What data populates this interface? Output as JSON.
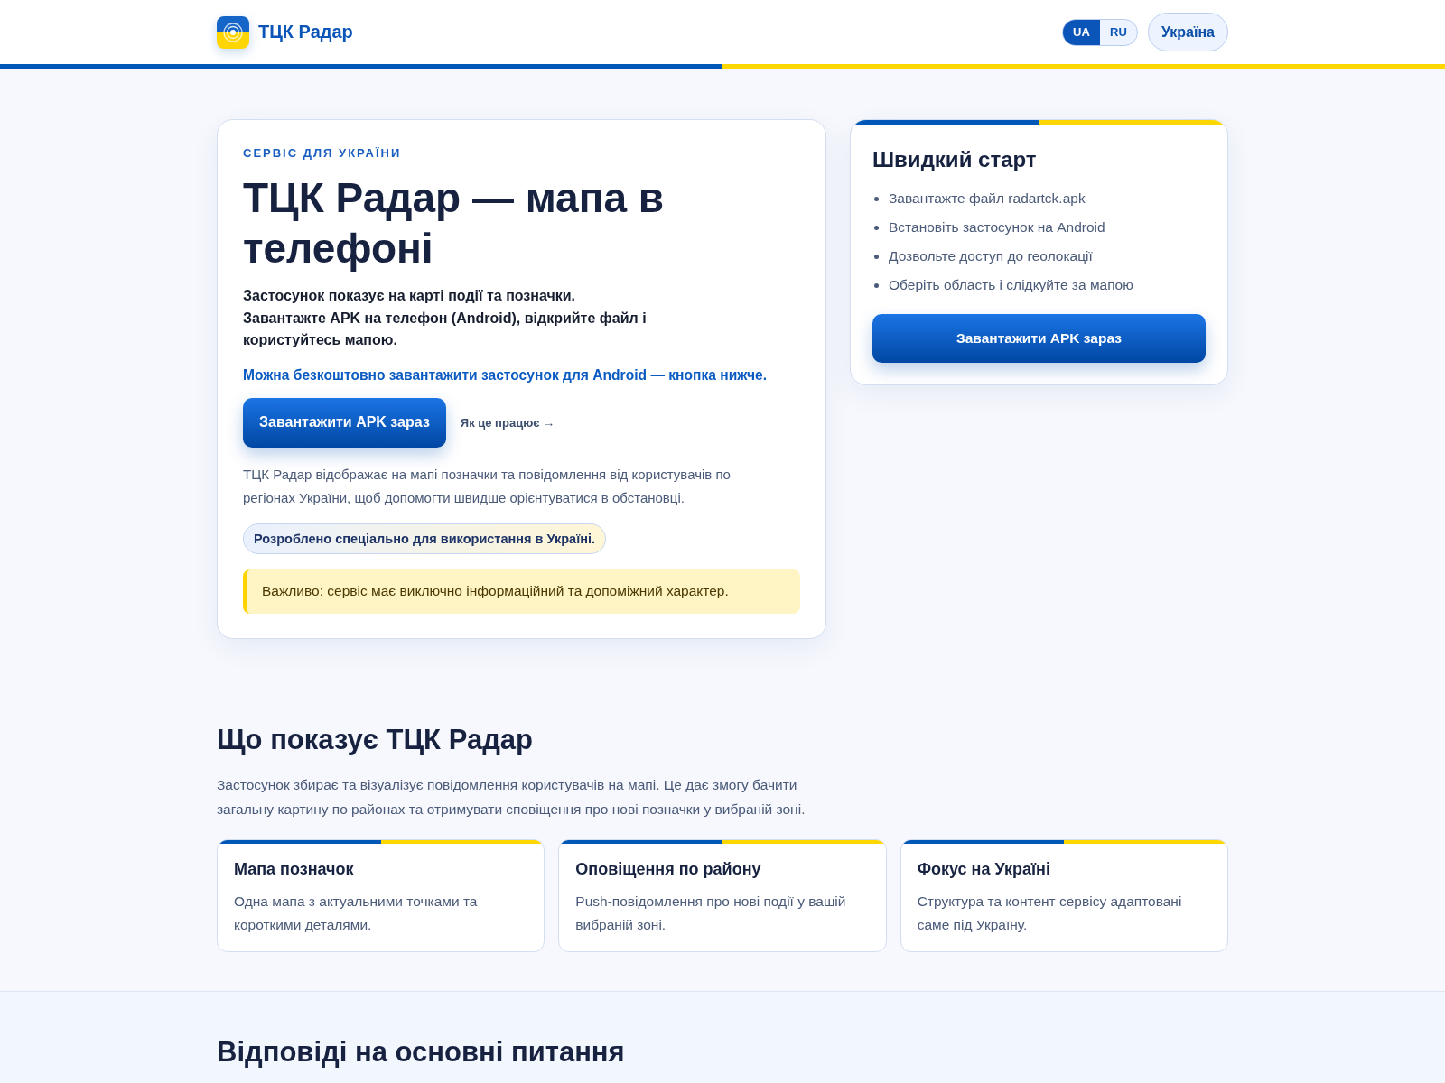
{
  "header": {
    "brand": "ТЦК Радар",
    "languages": [
      {
        "label": "UA",
        "selected": true
      },
      {
        "label": "RU",
        "selected": false
      }
    ],
    "country_button": "Україна"
  },
  "hero": {
    "eyebrow": "СЕРВІС ДЛЯ УКРАЇНИ",
    "title": "ТЦК Радар — мапа в телефоні",
    "lead": "Застосунок показує на карті події та позначки.\nЗавантажте APK на телефон (Android), відкрийте файл і користуйтесь мапою.",
    "free_note": "Можна безкоштовно завантажити застосунок для Android — кнопка нижче.",
    "download_button": "Завантажити APK зараз",
    "how_link": "Як це працює →",
    "description": "ТЦК Радар відображає на мапі позначки та повідомлення від користувачів по регіонах України, щоб допомогти швидше орієнтуватися в обстановці.",
    "badge": "Розроблено спеціально для використання в Україні.",
    "notice": "Важливо: сервіс має виключно інформаційний та допоміжний характер."
  },
  "quick_start": {
    "title": "Швидкий старт",
    "steps": [
      "Завантажте файл radartck.apk",
      "Встановіть застосунок на Android",
      "Дозвольте доступ до геолокації",
      "Оберіть область і слідкуйте за мапою"
    ],
    "download_button": "Завантажити APK зараз"
  },
  "features": {
    "title": "Що показує ТЦК Радар",
    "intro": "Застосунок збирає та візуалізує повідомлення користувачів на мапі. Це дає змогу бачити загальну картину по районах та отримувати сповіщення про нові позначки у вибраній зоні.",
    "cards": [
      {
        "title": "Мапа позначок",
        "text": "Одна мапа з актуальними точками та короткими деталями."
      },
      {
        "title": "Оповіщення по району",
        "text": "Push-повідомлення про нові події у вашій вибраній зоні."
      },
      {
        "title": "Фокус на Україні",
        "text": "Структура та контент сервісу адаптовані саме під Україну."
      }
    ]
  },
  "faq": {
    "title": "Відповіді на основні питання"
  }
}
